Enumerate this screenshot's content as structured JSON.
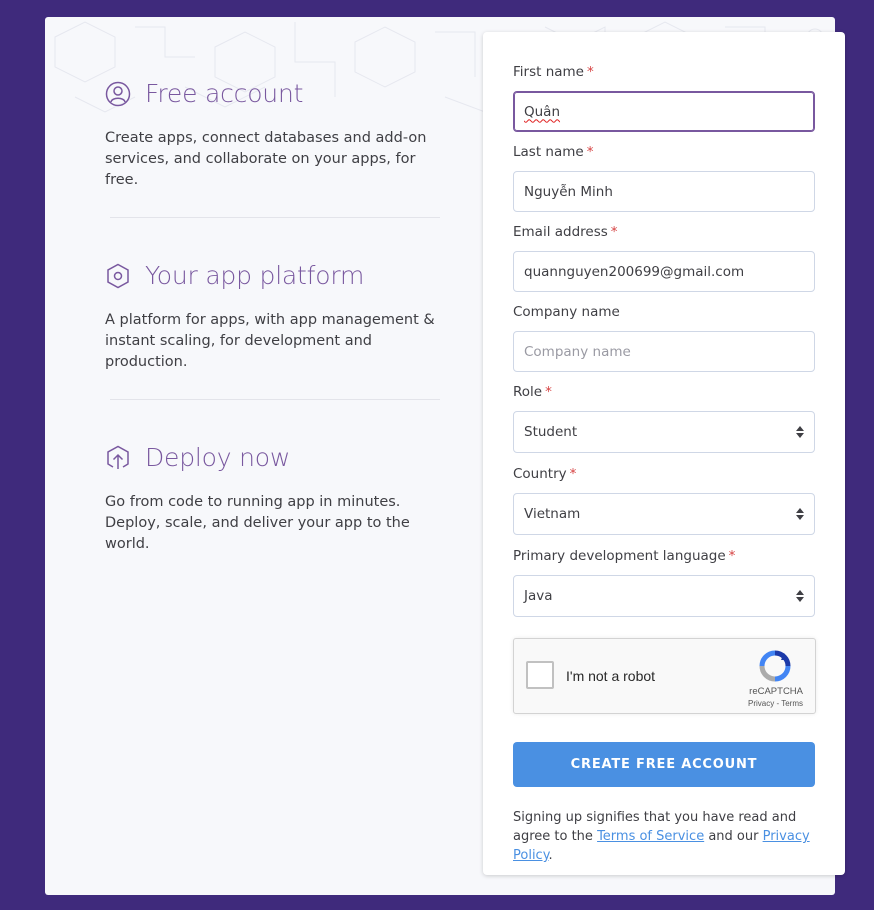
{
  "features": [
    {
      "icon": "user-circle-icon",
      "title": "Free account",
      "description": "Create apps, connect databases and add-on services, and collaborate on your apps, for free."
    },
    {
      "icon": "hexagon-icon",
      "title": "Your app platform",
      "description": "A platform for apps, with app management & instant scaling, for development and production."
    },
    {
      "icon": "upload-hexagon-icon",
      "title": "Deploy now",
      "description": "Go from code to running app in minutes. Deploy, scale, and deliver your app to the world."
    }
  ],
  "form": {
    "required_mark": "*",
    "first_name": {
      "label": "First name",
      "value": "Quân"
    },
    "last_name": {
      "label": "Last name",
      "value": "Nguyễn Minh"
    },
    "email": {
      "label": "Email address",
      "value": "quannguyen200699@gmail.com"
    },
    "company": {
      "label": "Company name",
      "placeholder": "Company name"
    },
    "role": {
      "label": "Role",
      "value": "Student"
    },
    "country": {
      "label": "Country",
      "value": "Vietnam"
    },
    "language": {
      "label": "Primary development language",
      "value": "Java"
    },
    "captcha": {
      "label": "I'm not a robot",
      "brand": "reCAPTCHA",
      "links": "Privacy - Terms"
    },
    "submit_label": "CREATE FREE ACCOUNT",
    "legal": {
      "prefix": "Signing up signifies that you have read and agree to the ",
      "terms_link": "Terms of Service",
      "middle": " and our ",
      "privacy_link": "Privacy Policy",
      "suffix": "."
    }
  },
  "colors": {
    "background": "#3f2a7c",
    "accent_purple": "#79589f",
    "button_blue": "#4a90e2",
    "required_red": "#d64242"
  }
}
